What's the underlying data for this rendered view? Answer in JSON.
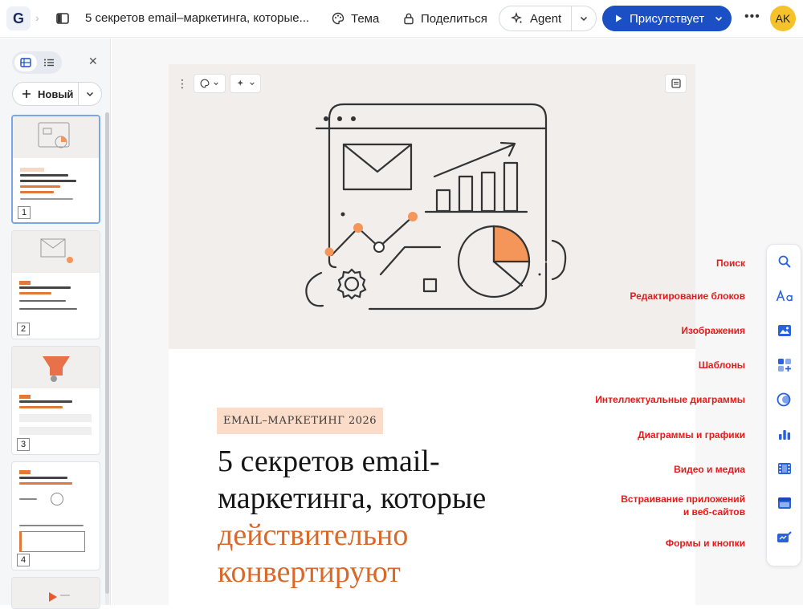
{
  "header": {
    "logo_letter": "G",
    "doc_title": "5 секретов email–маркетинга, которые...",
    "theme_label": "Тема",
    "share_label": "Поделиться",
    "agent_label": "Agent",
    "present_label": "Присутствует",
    "avatar_initials": "AK"
  },
  "left_panel": {
    "new_label": "Новый",
    "slides": [
      {
        "number": "1"
      },
      {
        "number": "2"
      },
      {
        "number": "3"
      },
      {
        "number": "4"
      }
    ]
  },
  "slide": {
    "tag": "EMAIL–МАРКЕТИНГ 2026",
    "headline_line1": "5 секретов email-",
    "headline_line2": "маркетинга, которые",
    "headline_line3": "действительно",
    "headline_line4": "конвертируют"
  },
  "insert_menu": {
    "items": [
      {
        "label": "Поиск",
        "icon": "search-icon"
      },
      {
        "label": "Редактирование блоков",
        "icon": "text-edit-icon"
      },
      {
        "label": "Изображения",
        "icon": "image-icon"
      },
      {
        "label": "Шаблоны",
        "icon": "templates-icon"
      },
      {
        "label": "Интеллектуальные диаграммы",
        "icon": "smart-diagram-icon"
      },
      {
        "label": "Диаграммы и графики",
        "icon": "bar-chart-icon"
      },
      {
        "label": "Видео и медиа",
        "icon": "video-icon"
      },
      {
        "label": "Встраивание приложений",
        "label2": "и веб-сайтов",
        "icon": "embed-icon"
      },
      {
        "label": "Формы и кнопки",
        "icon": "form-icon"
      }
    ]
  },
  "colors": {
    "accent_blue": "#1b4fc4",
    "accent_orange": "#f4955a",
    "annotation_red": "#e41b1b",
    "avatar_yellow": "#f5c22b"
  }
}
